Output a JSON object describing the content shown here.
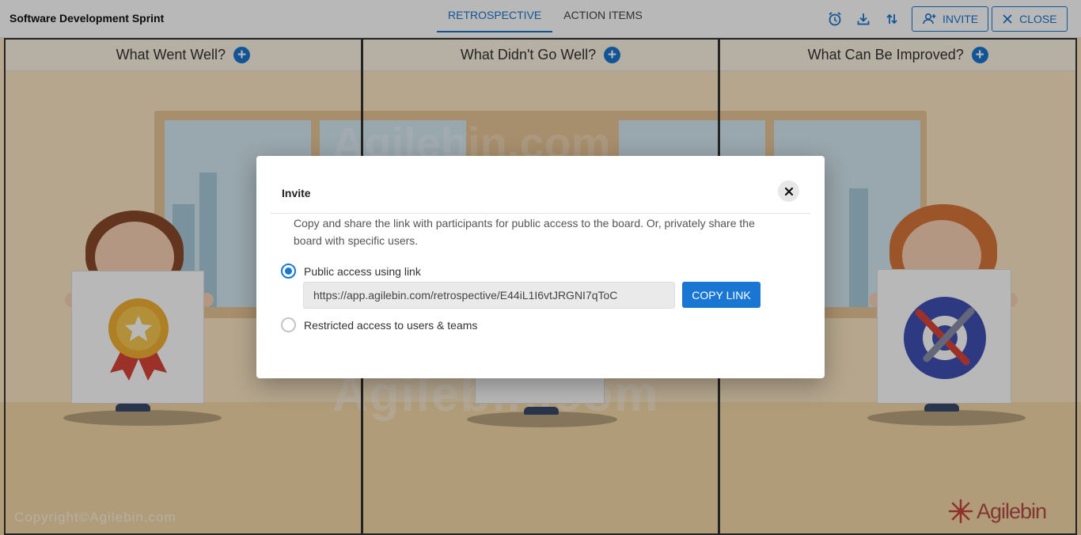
{
  "header": {
    "board_title": "Software Development Sprint",
    "tabs": [
      {
        "label": "RETROSPECTIVE",
        "active": true
      },
      {
        "label": "ACTION ITEMS",
        "active": false
      }
    ],
    "toolbar": {
      "timer_icon": "alarm-clock-icon",
      "download_icon": "download-icon",
      "sort_icon": "sort-arrows-icon",
      "invite_label": "INVITE",
      "close_label": "CLOSE"
    }
  },
  "columns": [
    {
      "title": "What Went Well?",
      "add_icon": "plus-circle-icon"
    },
    {
      "title": "What Didn't Go Well?",
      "add_icon": "plus-circle-icon"
    },
    {
      "title": "What Can Be Improved?",
      "add_icon": "plus-circle-icon"
    }
  ],
  "background": {
    "copyright": "Copyright©Agilebin.com",
    "logo_text": "Agilebin"
  },
  "dialog": {
    "title": "Invite",
    "description": "Copy and share the link with participants for public access to the board. Or, privately share the board with specific users.",
    "options": [
      {
        "label": "Public access using link",
        "checked": true
      },
      {
        "label": "Restricted access to users & teams",
        "checked": false
      }
    ],
    "link_value": "https://app.agilebin.com/retrospective/E44iL1I6vtJRGNI7qToC",
    "copy_label": "COPY LINK"
  },
  "colors": {
    "accent": "#1976d2",
    "background_warm": "#fbe7c4"
  }
}
